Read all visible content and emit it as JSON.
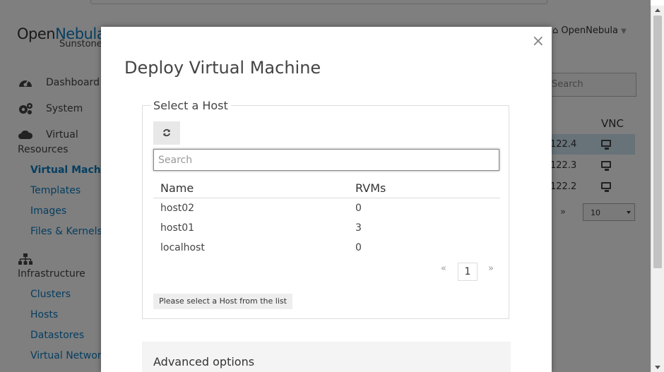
{
  "app": {
    "logo_prefix": "Open",
    "logo_brand": "Nebula",
    "logo_sub": "Sunstone",
    "user_label": "OpenNebula",
    "search_placeholder": "Search",
    "nav": {
      "dashboard": "Dashboard",
      "system": "System",
      "virtual_resources_1": "Virtual",
      "virtual_resources_2": "Resources",
      "virtual_machines": "Virtual Machines",
      "templates": "Templates",
      "images": "Images",
      "files_kernels": "Files & Kernels",
      "infrastructure": "Infrastructure",
      "clusters": "Clusters",
      "hosts": "Hosts",
      "datastores": "Datastores",
      "virtual_networks": "Virtual Networks"
    },
    "vnc_header": "VNC",
    "vm_rows": [
      {
        "ip": "122.4"
      },
      {
        "ip": "122.3"
      },
      {
        "ip": "122.2"
      }
    ],
    "pager_next": "»",
    "page_size": "10"
  },
  "modal": {
    "close": "×",
    "title": "Deploy Virtual Machine",
    "section_title": "Select a Host",
    "search_placeholder": "Search",
    "columns": {
      "name": "Name",
      "rvms": "RVMs"
    },
    "hosts": [
      {
        "name": "host02",
        "rvms": "0"
      },
      {
        "name": "host01",
        "rvms": "3"
      },
      {
        "name": "localhost",
        "rvms": "0"
      }
    ],
    "pager": {
      "prev": "«",
      "current": "1",
      "next": "»"
    },
    "hint": "Please select a Host from the list",
    "advanced": "Advanced options"
  }
}
